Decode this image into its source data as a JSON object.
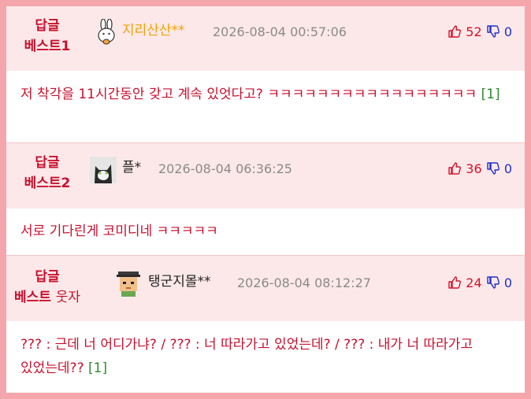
{
  "comments": [
    {
      "badge_line1": "답글",
      "badge_line2": "베스트1",
      "badge_extra": "",
      "nickname": "지리산산**",
      "nickname_color": "#f0a400",
      "timestamp": "2026-08-04 00:57:06",
      "upvotes": "52",
      "downvotes": "0",
      "text": "저 착각을 11시간동안 갖고 계속 있엇다고? ㅋㅋㅋㅋㅋㅋㅋㅋㅋㅋㅋㅋㅋㅋㅋㅋㅋ",
      "ref": "[1]",
      "avatar_icon": "rabbit-avatar-icon"
    },
    {
      "badge_line1": "답글",
      "badge_line2": "베스트2",
      "badge_extra": "",
      "nickname": "플*",
      "nickname_color": "#222222",
      "timestamp": "2026-08-04 06:36:25",
      "upvotes": "36",
      "downvotes": "0",
      "text": "서로 기다린게 코미디네 ㅋㅋㅋㅋㅋ",
      "ref": "",
      "avatar_icon": "cat-avatar-icon"
    },
    {
      "badge_line1": "답글",
      "badge_line2": "베스트",
      "badge_extra": "웃자",
      "nickname": "탱군지몰**",
      "nickname_color": "#222222",
      "timestamp": "2026-08-04 08:12:27",
      "upvotes": "24",
      "downvotes": "0",
      "text": "??? : 근데 너 어디가냐? / ??? : 너 따라가고 있었는데? / ??? : 내가 너 따라가고 있었는데??",
      "ref": "[1]",
      "avatar_icon": "pixel-character-avatar-icon"
    }
  ]
}
